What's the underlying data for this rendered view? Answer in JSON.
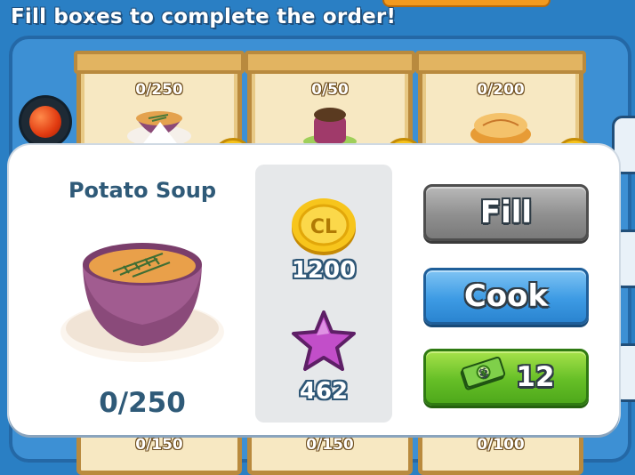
{
  "header": {
    "title": "Fill boxes to complete the order!"
  },
  "order_boxes": [
    {
      "count": "0/250",
      "item": "Potato Soup"
    },
    {
      "count": "0/50",
      "item": "cake"
    },
    {
      "count": "0/200",
      "item": "pie"
    }
  ],
  "lower_boxes": [
    {
      "count": "0/150"
    },
    {
      "count": "0/150"
    },
    {
      "count": "0/100"
    }
  ],
  "popup": {
    "item_name": "Potato Soup",
    "item_count": "0/250",
    "reward_coin_label": "CL",
    "reward_coins": "1200",
    "reward_stars": "462",
    "fill_label": "Fill",
    "cook_label": "Cook",
    "buy_price": "12"
  },
  "icons": {
    "coin": "cl-coin-icon",
    "star": "star-icon",
    "cash": "cash-icon",
    "indicator": "red-light-icon"
  },
  "colors": {
    "background": "#2a7fc4",
    "fill_button": "#8f8f8f",
    "cook_button": "#3d9be4",
    "buy_button": "#66bf27",
    "text_dark": "#2f5a78",
    "star": "#c24ec9",
    "coin": "#f6c21b"
  }
}
